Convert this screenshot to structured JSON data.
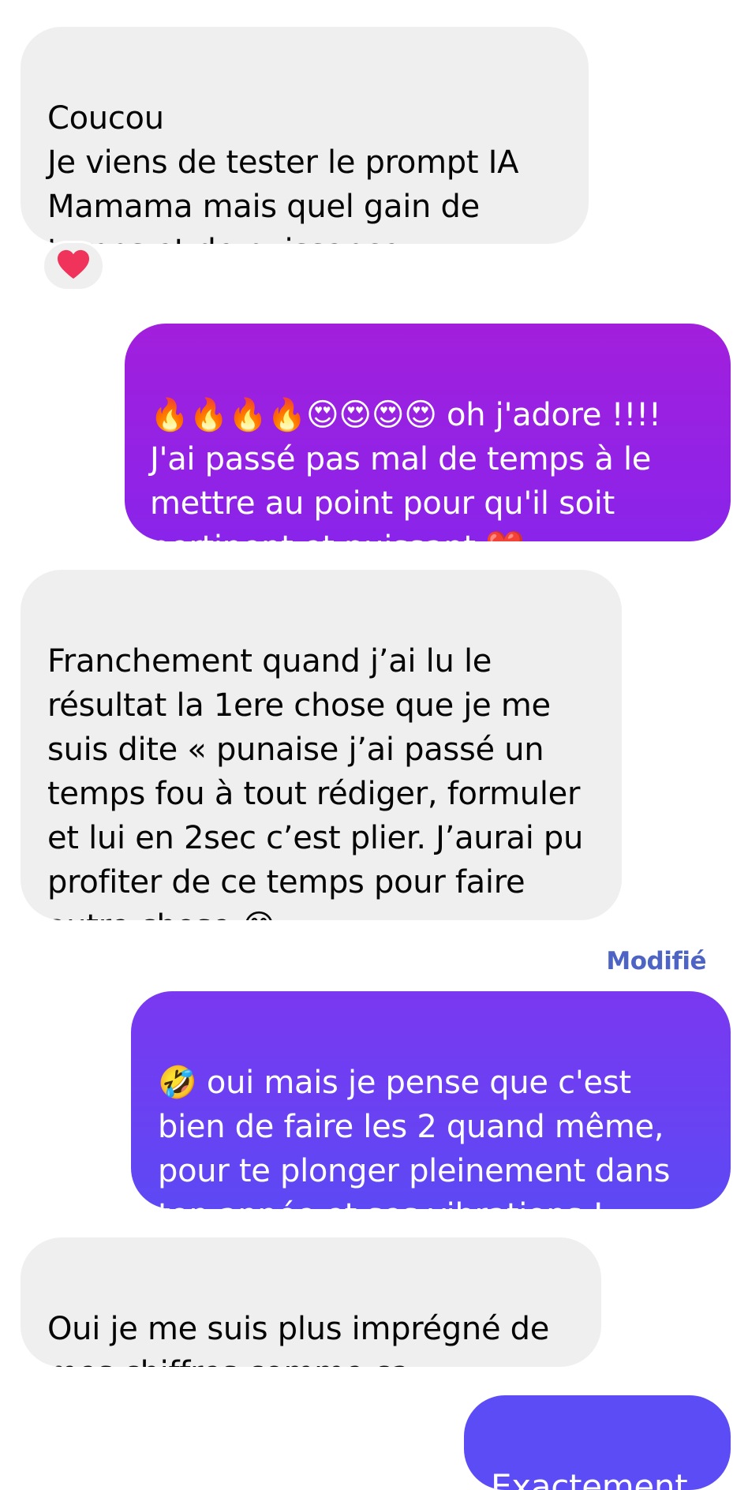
{
  "colors": {
    "incoming_bubble": "#efefef",
    "outgoing_gradient_1": [
      "#a21fdc",
      "#8a24ea"
    ],
    "outgoing_gradient_2": [
      "#7a38f0",
      "#5d49f4"
    ],
    "outgoing_single": "#5b4cf6",
    "edited_label": "#4e64c4",
    "heart": "#f0335b"
  },
  "messages": [
    {
      "direction": "incoming",
      "text": "Coucou\nJe viens de tester le prompt IA Mamama mais quel gain de temps et de puissance",
      "reaction": "heart-icon"
    },
    {
      "direction": "outgoing",
      "text": "🔥🔥🔥🔥😍😍😍😍 oh j'adore !!!!\nJ'ai passé pas mal de temps à le mettre au point pour qu'il soit pertinent et puissant ❤️"
    },
    {
      "direction": "incoming",
      "text": "Franchement quand j’ai lu le résultat la 1ere chose que je me suis dite « punaise j’ai passé un temps fou à tout rédiger, formuler et lui en 2sec c’est plier. J’aurai pu profiter de ce temps pour faire autre chose 😂 »"
    },
    {
      "direction": "outgoing",
      "edited_label": "Modifié",
      "text": "🤣 oui mais je pense que c'est bien de faire les 2 quand même, pour te plonger pleinement dans ton année et ses vibrations !"
    },
    {
      "direction": "incoming",
      "text": "Oui je me suis plus imprégné de mes chiffres comme ça"
    },
    {
      "direction": "outgoing",
      "text": "Exactement !"
    }
  ]
}
